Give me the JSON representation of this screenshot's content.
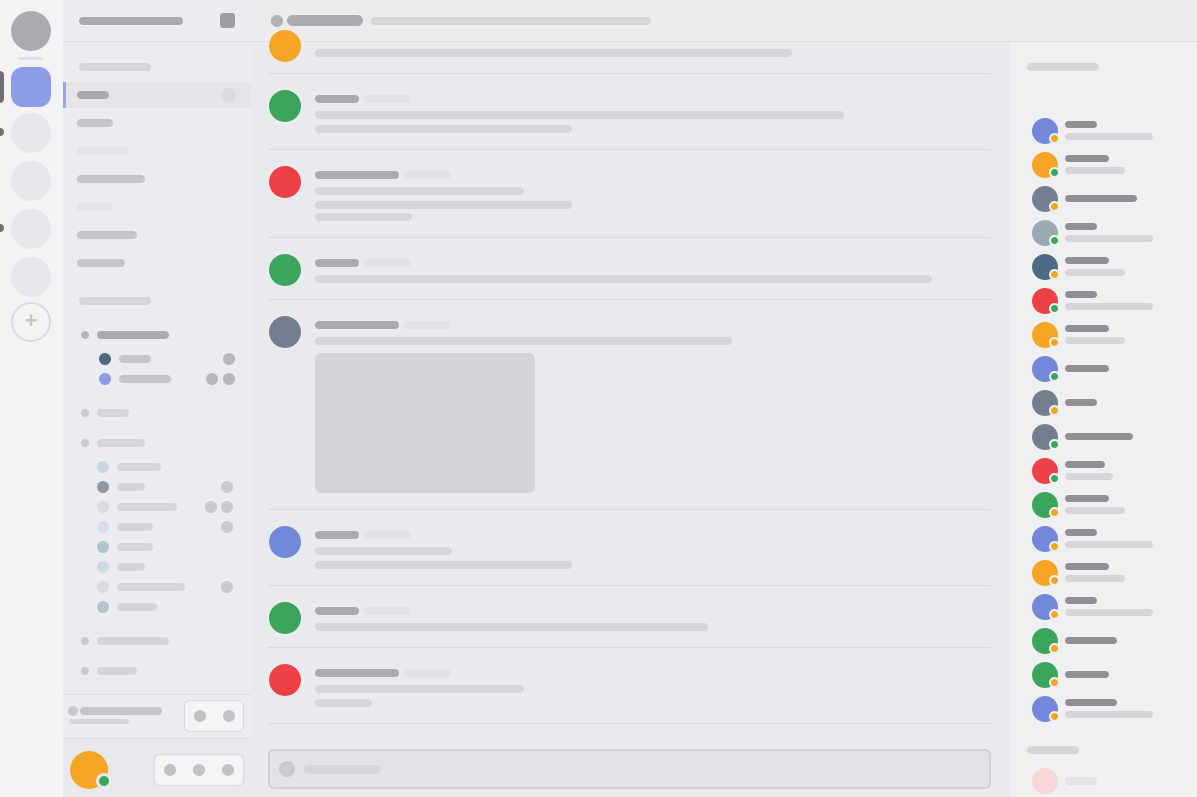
{
  "colors": {
    "accent": "#8c9ce8",
    "online": "#3ba55c",
    "idle": "#f6a623",
    "dnd": "#ed4245",
    "blurple": "#7289da",
    "slate": "#747f8d",
    "teal": "#4b6b80",
    "grey_blue": "#99aab5"
  },
  "servers": [
    "home-server",
    "active-server",
    "server-3",
    "server-4",
    "server-5",
    "server-6"
  ],
  "add_server_icon": "+",
  "messages": [
    {
      "avatar_color": "#f6a623"
    },
    {
      "avatar_color": "#3ba55c"
    },
    {
      "avatar_color": "#ed4245"
    },
    {
      "avatar_color": "#3ba55c"
    },
    {
      "avatar_color": "#747f8d",
      "has_attachment": true
    },
    {
      "avatar_color": "#7289da"
    },
    {
      "avatar_color": "#3ba55c"
    },
    {
      "avatar_color": "#ed4245"
    }
  ],
  "members": [
    {
      "avatar": "#7289da",
      "status": "#f6a623",
      "two_lines": true
    },
    {
      "avatar": "#f6a623",
      "status": "#3ba55c",
      "two_lines": true
    },
    {
      "avatar": "#747f8d",
      "status": "#f6a623",
      "two_lines": false
    },
    {
      "avatar": "#99aab5",
      "status": "#3ba55c",
      "two_lines": true
    },
    {
      "avatar": "#4b6b80",
      "status": "#f6a623",
      "two_lines": true
    },
    {
      "avatar": "#ed4245",
      "status": "#3ba55c",
      "two_lines": true
    },
    {
      "avatar": "#f6a623",
      "status": "#f6a623",
      "two_lines": true
    },
    {
      "avatar": "#7289da",
      "status": "#3ba55c",
      "two_lines": false
    },
    {
      "avatar": "#747f8d",
      "status": "#f6a623",
      "two_lines": false
    },
    {
      "avatar": "#747f8d",
      "status": "#3ba55c",
      "two_lines": false
    },
    {
      "avatar": "#ed4245",
      "status": "#3ba55c",
      "two_lines": true
    },
    {
      "avatar": "#3ba55c",
      "status": "#f6a623",
      "two_lines": true
    },
    {
      "avatar": "#7289da",
      "status": "#f6a623",
      "two_lines": true
    },
    {
      "avatar": "#f6a623",
      "status": "#f6a623",
      "two_lines": true
    },
    {
      "avatar": "#7289da",
      "status": "#f6a623",
      "two_lines": true
    },
    {
      "avatar": "#3ba55c",
      "status": "#f6a623",
      "two_lines": false
    },
    {
      "avatar": "#3ba55c",
      "status": "#f6a623",
      "two_lines": false
    },
    {
      "avatar": "#7289da",
      "status": "#f6a623",
      "two_lines": true
    }
  ],
  "offline_member_color": "#f8d7da"
}
